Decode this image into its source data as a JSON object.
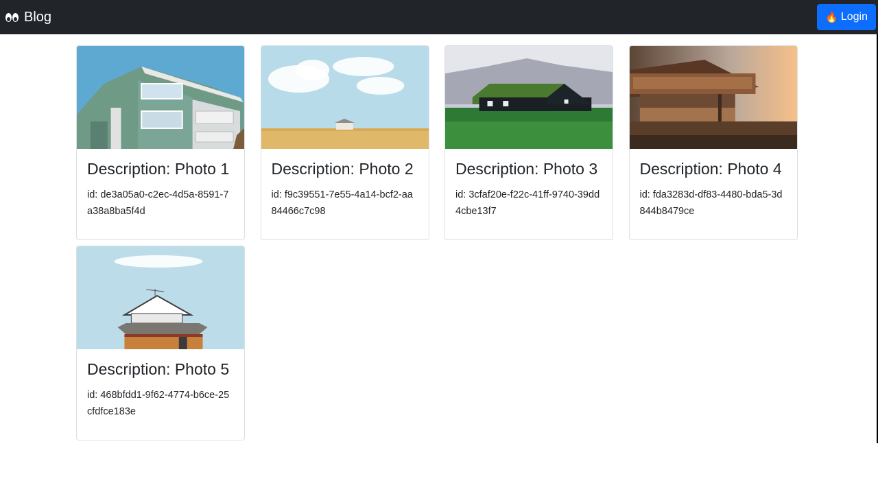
{
  "navbar": {
    "brand_label": "Blog",
    "brand_icon": "eyes-icon",
    "login_label": "Login",
    "login_icon": "fire-icon",
    "background": "#212529",
    "login_color": "#0d6efd"
  },
  "posts": [
    {
      "title": "Description: Photo 1",
      "id_text": "id: de3a05a0-c2ec-4d5a-8591-7a38a8ba5f4d",
      "image": "apartment-building"
    },
    {
      "title": "Description: Photo 2",
      "id_text": "id: f9c39551-7e55-4a14-bcf2-aa84466c7c98",
      "image": "house-in-wheat-field"
    },
    {
      "title": "Description: Photo 3",
      "id_text": "id: 3cfaf20e-f22c-41ff-9740-39dd4cbe13f7",
      "image": "green-roof-cabin"
    },
    {
      "title": "Description: Photo 4",
      "id_text": "id: fda3283d-df83-4480-bda5-3d844b8479ce",
      "image": "wooden-house-sunset"
    },
    {
      "title": "Description: Photo 5",
      "id_text": "id: 468bfdd1-9f62-4774-b6ce-25cfdfce183e",
      "image": "small-house-sky"
    }
  ]
}
